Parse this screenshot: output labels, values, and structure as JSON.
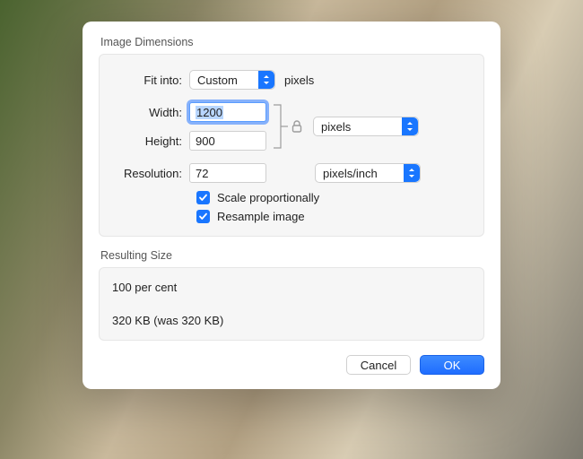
{
  "dimensions_group": {
    "legend": "Image Dimensions",
    "fit_into_label": "Fit into:",
    "fit_into_value": "Custom",
    "fit_into_unit_label": "pixels",
    "width_label": "Width:",
    "width_value": "1200",
    "height_label": "Height:",
    "height_value": "900",
    "wh_unit_value": "pixels",
    "resolution_label": "Resolution:",
    "resolution_value": "72",
    "resolution_unit_value": "pixels/inch",
    "scale_label": "Scale proportionally",
    "resample_label": "Resample image"
  },
  "result_group": {
    "legend": "Resulting Size",
    "percent_line": "100 per cent",
    "size_line": "320 KB (was 320 KB)"
  },
  "buttons": {
    "cancel": "Cancel",
    "ok": "OK"
  }
}
